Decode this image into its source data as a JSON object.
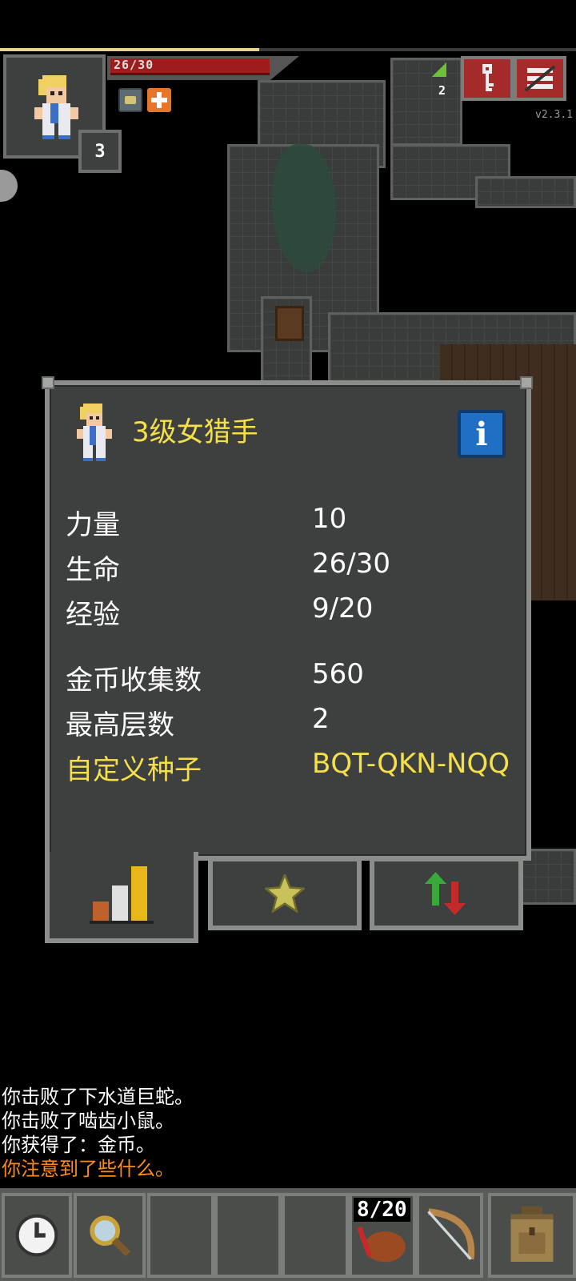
{
  "hud": {
    "hp_text": "26/30",
    "hp_fraction": 0.867,
    "xp_fraction": 0.45,
    "level": "3",
    "version": "v2.3.1",
    "depth": "2",
    "buttons": [
      {
        "name": "journal-button",
        "icon": "key-icon"
      },
      {
        "name": "menu-button",
        "icon": "menu-icon"
      }
    ]
  },
  "hero_window": {
    "title": "3级女猎手",
    "stats": [
      {
        "label": "力量",
        "value": "10"
      },
      {
        "label": "生命",
        "value": "26/30"
      },
      {
        "label": "经验",
        "value": "9/20"
      },
      {
        "label": "金币收集数",
        "value": "560"
      },
      {
        "label": "最高层数",
        "value": "2"
      },
      {
        "label": "自定义种子",
        "value": "BQT-QKN-NQQ"
      }
    ],
    "tabs": [
      {
        "name": "stats-tab",
        "icon": "bar-chart-icon"
      },
      {
        "name": "talents-tab",
        "icon": "star-icon"
      },
      {
        "name": "buffs-tab",
        "icon": "up-down-arrows-icon"
      }
    ]
  },
  "log": [
    {
      "text": "你击败了下水道巨蛇。",
      "color": "#ffffff"
    },
    {
      "text": "你击败了啮齿小鼠。",
      "color": "#ffffff"
    },
    {
      "text": "你获得了：金币。",
      "color": "#ffffff"
    },
    {
      "text": "你注意到了些什么。",
      "color": "#ff8c1a"
    }
  ],
  "toolbar": {
    "quiver_count": "8/20",
    "buttons": [
      "wait-icon",
      "search-icon",
      "empty",
      "empty",
      "empty",
      "quiver-icon",
      "bow-icon",
      "backpack-icon"
    ]
  }
}
